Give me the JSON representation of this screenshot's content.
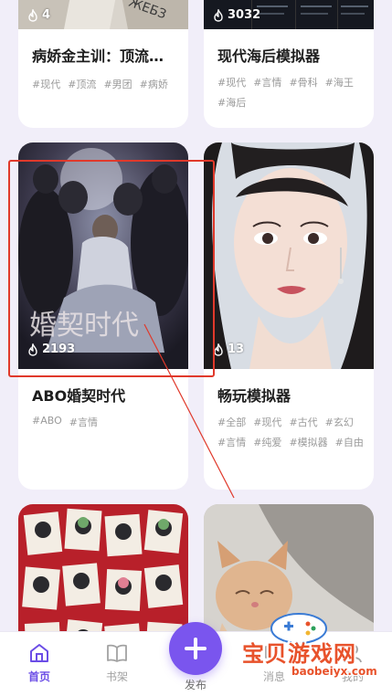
{
  "cards": [
    {
      "title": "病娇金主训：顶流…",
      "heat": "4",
      "tags": [
        "#现代",
        "#顶流",
        "#男团",
        "#病娇"
      ]
    },
    {
      "title": "现代海后模拟器",
      "heat": "3032",
      "tags": [
        "#现代",
        "#言情",
        "#骨科",
        "#海王",
        "#海后"
      ]
    },
    {
      "title": "ABO婚契时代",
      "heat": "2193",
      "tags": [
        "#ABO",
        "#言情"
      ],
      "cover_text": "婚契时代"
    },
    {
      "title": "畅玩模拟器",
      "heat": "13",
      "tags": [
        "#全部",
        "#现代",
        "#古代",
        "#玄幻",
        "#言情",
        "#纯爱",
        "#模拟器",
        "#自由"
      ]
    },
    {
      "title": "",
      "heat": "",
      "tags": []
    },
    {
      "title": "",
      "heat": "",
      "tags": []
    }
  ],
  "nav": {
    "home": "首页",
    "bookshelf": "书架",
    "publish": "发布",
    "messages": "消息",
    "mine": "我的"
  },
  "watermark": {
    "title": "宝贝游戏网",
    "url": "baobeiyx.com"
  },
  "colors": {
    "accent": "#7a55ee",
    "annotation": "#e0392b",
    "background": "#f1eef9"
  }
}
